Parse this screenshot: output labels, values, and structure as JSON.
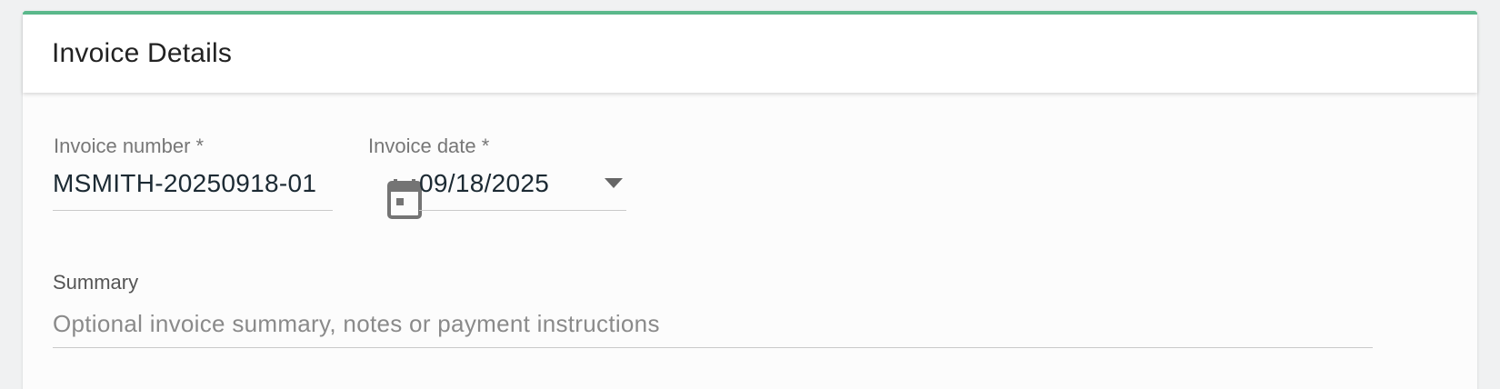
{
  "card": {
    "title": "Invoice Details",
    "accent_color": "#5bb98c"
  },
  "invoice_number": {
    "label": "Invoice number *",
    "value": "MSMITH-20250918-01"
  },
  "invoice_date": {
    "label": "Invoice date *",
    "value": "09/18/2025",
    "icon": "calendar-icon",
    "dropdown_icon": "chevron-down-icon"
  },
  "summary": {
    "label": "Summary",
    "placeholder": "Optional invoice summary, notes or payment instructions",
    "value": ""
  }
}
